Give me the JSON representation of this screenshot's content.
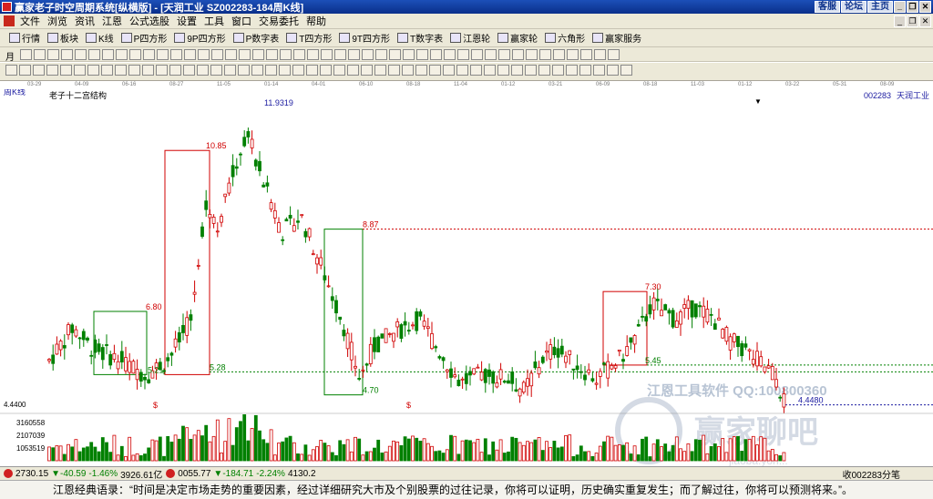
{
  "window": {
    "title": "赢家老子时空周期系统[纵横版] - [天润工业   SZ002283-184周K线]",
    "right_buttons": [
      "客服",
      "论坛",
      "主页"
    ]
  },
  "menu": [
    "文件",
    "浏览",
    "资讯",
    "江恩",
    "公式选股",
    "设置",
    "工具",
    "窗口",
    "交易委托",
    "帮助"
  ],
  "toolbar": [
    {
      "icon": "grid-icon",
      "label": "行情"
    },
    {
      "icon": "block-icon",
      "label": "板块"
    },
    {
      "icon": "kline-icon",
      "label": "K线"
    },
    {
      "icon": "p-square-icon",
      "label": "P四方形"
    },
    {
      "icon": "9p-square-icon",
      "label": "9P四方形"
    },
    {
      "icon": "pn-icon",
      "label": "P数字表"
    },
    {
      "icon": "t-square-icon",
      "label": "T四方形"
    },
    {
      "icon": "9t-square-icon",
      "label": "9T四方形"
    },
    {
      "icon": "tn-icon",
      "label": "T数字表"
    },
    {
      "icon": "gann-wheel-icon",
      "label": "江恩轮"
    },
    {
      "icon": "winner-wheel-icon",
      "label": "赢家轮"
    },
    {
      "icon": "hexagon-icon",
      "label": "六角形"
    },
    {
      "icon": "service-icon",
      "label": "赢家服务"
    }
  ],
  "period_selector": "月",
  "date_axis": [
    "03-29",
    "04-09",
    "06-16",
    "08-27",
    "11-05",
    "01-14",
    "04-01",
    "06-10",
    "08-18",
    "11-04",
    "01-12",
    "03-21",
    "06-09",
    "08-18",
    "11-03",
    "01-12",
    "03-22",
    "05-31",
    "08-09"
  ],
  "chart": {
    "period_label": "周K线",
    "structure_label": "老子十二宫结构",
    "stock_code": "002283",
    "stock_name": "天润工业",
    "price_labels": [
      {
        "text": "11.9319",
        "color": "#1a1aa0"
      },
      {
        "text": "10.85",
        "color": "#d00000"
      },
      {
        "text": "8.87",
        "color": "#d00000"
      },
      {
        "text": "7.30",
        "color": "#d00000"
      },
      {
        "text": "6.80",
        "color": "#d00000"
      },
      {
        "text": "5.21",
        "color": "#008000"
      },
      {
        "text": "5.28",
        "color": "#008000"
      },
      {
        "text": "5.45",
        "color": "#008000"
      },
      {
        "text": "4.70",
        "color": "#008000"
      },
      {
        "text": "4.4480",
        "color": "#1a1aa0"
      }
    ],
    "left_price": "4.4400",
    "marker": "$",
    "volume_axis": [
      "3160558",
      "2107039",
      "1053519"
    ],
    "watermark_main": "江恩工具软件  QQ:100800360",
    "watermark_logo": "赢家聊吧",
    "watermark_url": "jiaoba.yon..."
  },
  "status": {
    "sh_value": "2730.15",
    "sh_change": "▼-40.59",
    "sh_pct": "-1.46%",
    "sh_amount": "3926.61亿",
    "sz_value": "0055.77",
    "sz_change": "▼-184.71",
    "sz_pct": "-2.24%",
    "sz_amount": "4130.2",
    "right_text": "收002283分笔"
  },
  "quote": "江恩经典语录：“时间是决定市场走势的重要因素，经过详细研究大市及个别股票的过往记录，你将可以证明，历史确实重复发生；而了解过往，你将可以预测将来。”。",
  "colors": {
    "up": "#d00000",
    "down": "#008000",
    "titlebar": "#0a2f8a"
  }
}
